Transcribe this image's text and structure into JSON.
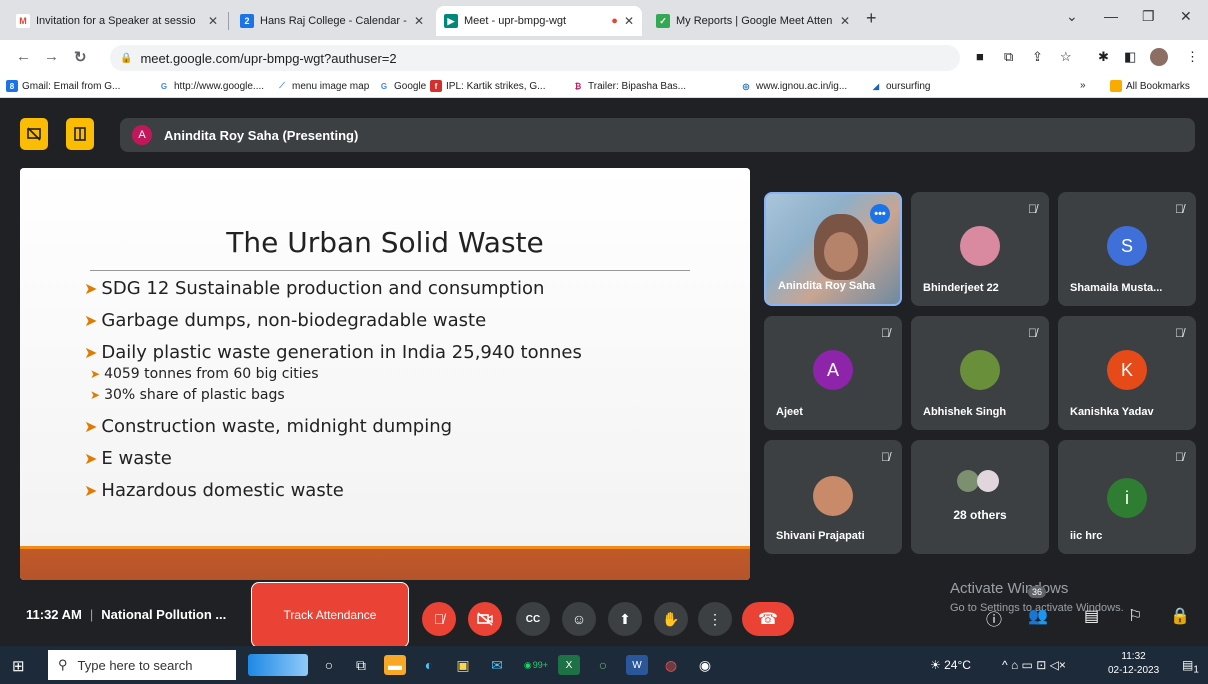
{
  "browser": {
    "tabs": [
      {
        "label": "Invitation for a Speaker at sessio",
        "icon": "gmail-icon",
        "color": "#ea4335"
      },
      {
        "label": "Hans Raj College - Calendar - Sa",
        "icon": "calendar-icon",
        "color": "#1a73e8"
      },
      {
        "label": "Meet - upr-bmpg-wgt",
        "icon": "meet-icon",
        "color": "#00897b"
      },
      {
        "label": "My Reports | Google Meet Atten",
        "icon": "reports-icon",
        "color": "#34a853"
      }
    ],
    "fav_letters": {
      "calendar": "2"
    },
    "url": "meet.google.com/upr-bmpg-wgt?authuser=2",
    "bookmarks": [
      "Gmail: Email from G...",
      "http://www.google....",
      "menu image map",
      "Google",
      "IPL: Kartik strikes, G...",
      "Trailer: Bipasha Bas...",
      "www.ignou.ac.in/ig...",
      "oursurfing"
    ],
    "all_bookmarks": "All Bookmarks"
  },
  "meet": {
    "presenter_initial": "A",
    "presenter_label": "Anindita Roy Saha (Presenting)",
    "slide": {
      "title": "The Urban Solid Waste",
      "bullets": [
        "SDG 12 Sustainable production and consumption",
        "Garbage dumps, non-biodegradable waste",
        "Daily plastic waste generation in India 25,940 tonnes",
        "4059 tonnes from 60 big cities",
        "30% share of plastic bags",
        "Construction waste, midnight dumping",
        "E waste",
        "Hazardous domestic waste"
      ]
    },
    "participants": [
      {
        "name": "Anindita Roy Saha",
        "initial": "",
        "color": ""
      },
      {
        "name": "Bhinderjeet 22",
        "initial": "",
        "color": "#d98aa0"
      },
      {
        "name": "Shamaila Musta...",
        "initial": "S",
        "color": "#3f6fd8"
      },
      {
        "name": "Ajeet",
        "initial": "A",
        "color": "#8e24aa"
      },
      {
        "name": "Abhishek Singh",
        "initial": "",
        "color": "#6a8f3a"
      },
      {
        "name": "Kanishka Yadav",
        "initial": "K",
        "color": "#e64a19"
      },
      {
        "name": "Shivani Prajapati",
        "initial": "",
        "color": "#c98a6a"
      },
      {
        "name": "28 others",
        "initial": "",
        "color": "#9e9e9e"
      },
      {
        "name": "iic hrc",
        "initial": "i",
        "color": "#2e7d32"
      }
    ],
    "time": "11:32 AM",
    "meeting_name": "National Pollution ...",
    "track_attendance": "Track Attendance",
    "participant_count": "36",
    "watermark_line1": "Activate Windows",
    "watermark_line2": "Go to Settings to activate Windows."
  },
  "taskbar": {
    "search_placeholder": "Type here to search",
    "whatsapp_badge": "99+",
    "temperature": "24°C",
    "time": "11:32",
    "date": "02-12-2023",
    "notification_count": "1"
  }
}
